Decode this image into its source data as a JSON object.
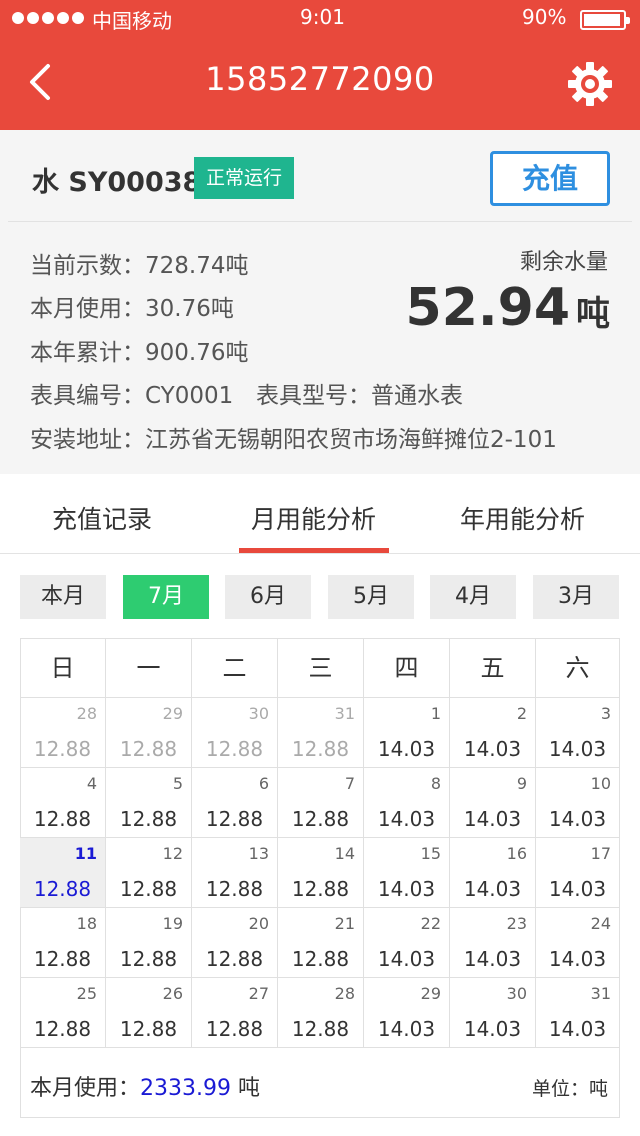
{
  "status_bar": {
    "carrier": "中国移动",
    "time": "9:01",
    "battery": "90%"
  },
  "nav": {
    "title": "15852772090",
    "back_icon": "chevron-left-icon",
    "settings_icon": "gear-icon"
  },
  "meter": {
    "name": "水 SY00038",
    "status": "正常运行",
    "recharge_label": "充值",
    "current_reading": "当前示数：728.74吨",
    "month_usage": "本月使用：30.76吨",
    "year_total": "本年累计：900.76吨",
    "meter_no": "表具编号：CY0001",
    "meter_type": "表具型号：普通水表",
    "address": "安装地址：江苏省无锡朝阳农贸市场海鲜摊位2-101",
    "remaining_label": "剩余水量",
    "remaining_value": "52.94",
    "remaining_unit": "吨"
  },
  "tabs": [
    "充值记录",
    "月用能分析",
    "年用能分析"
  ],
  "months": [
    "本月",
    "7月",
    "6月",
    "5月",
    "4月",
    "3月"
  ],
  "weekdays": [
    "日",
    "一",
    "二",
    "三",
    "四",
    "五",
    "六"
  ],
  "calendar": [
    [
      {
        "d": "28",
        "v": "12.88"
      },
      {
        "d": "29",
        "v": "12.88"
      },
      {
        "d": "30",
        "v": "12.88"
      },
      {
        "d": "31",
        "v": "12.88"
      },
      {
        "d": "1",
        "v": "14.03"
      },
      {
        "d": "2",
        "v": "14.03"
      },
      {
        "d": "3",
        "v": "14.03"
      }
    ],
    [
      {
        "d": "4",
        "v": "12.88"
      },
      {
        "d": "5",
        "v": "12.88"
      },
      {
        "d": "6",
        "v": "12.88"
      },
      {
        "d": "7",
        "v": "12.88"
      },
      {
        "d": "8",
        "v": "14.03"
      },
      {
        "d": "9",
        "v": "14.03"
      },
      {
        "d": "10",
        "v": "14.03"
      }
    ],
    [
      {
        "d": "11",
        "v": "12.88"
      },
      {
        "d": "12",
        "v": "12.88"
      },
      {
        "d": "13",
        "v": "12.88"
      },
      {
        "d": "14",
        "v": "12.88"
      },
      {
        "d": "15",
        "v": "14.03"
      },
      {
        "d": "16",
        "v": "14.03"
      },
      {
        "d": "17",
        "v": "14.03"
      }
    ],
    [
      {
        "d": "18",
        "v": "12.88"
      },
      {
        "d": "19",
        "v": "12.88"
      },
      {
        "d": "20",
        "v": "12.88"
      },
      {
        "d": "21",
        "v": "12.88"
      },
      {
        "d": "22",
        "v": "14.03"
      },
      {
        "d": "23",
        "v": "14.03"
      },
      {
        "d": "24",
        "v": "14.03"
      }
    ],
    [
      {
        "d": "25",
        "v": "12.88"
      },
      {
        "d": "26",
        "v": "12.88"
      },
      {
        "d": "27",
        "v": "12.88"
      },
      {
        "d": "28",
        "v": "12.88"
      },
      {
        "d": "29",
        "v": "14.03"
      },
      {
        "d": "30",
        "v": "14.03"
      },
      {
        "d": "31",
        "v": "14.03"
      }
    ]
  ],
  "footer": {
    "usage_label": "本月使用：",
    "usage_value": "2333.99",
    "usage_unit": " 吨",
    "unit_note": "单位：吨"
  },
  "colors": {
    "header": "#e8493c",
    "badge": "#1fb58f",
    "active_month": "#2ecc71",
    "link_blue": "#2e8fe0"
  }
}
